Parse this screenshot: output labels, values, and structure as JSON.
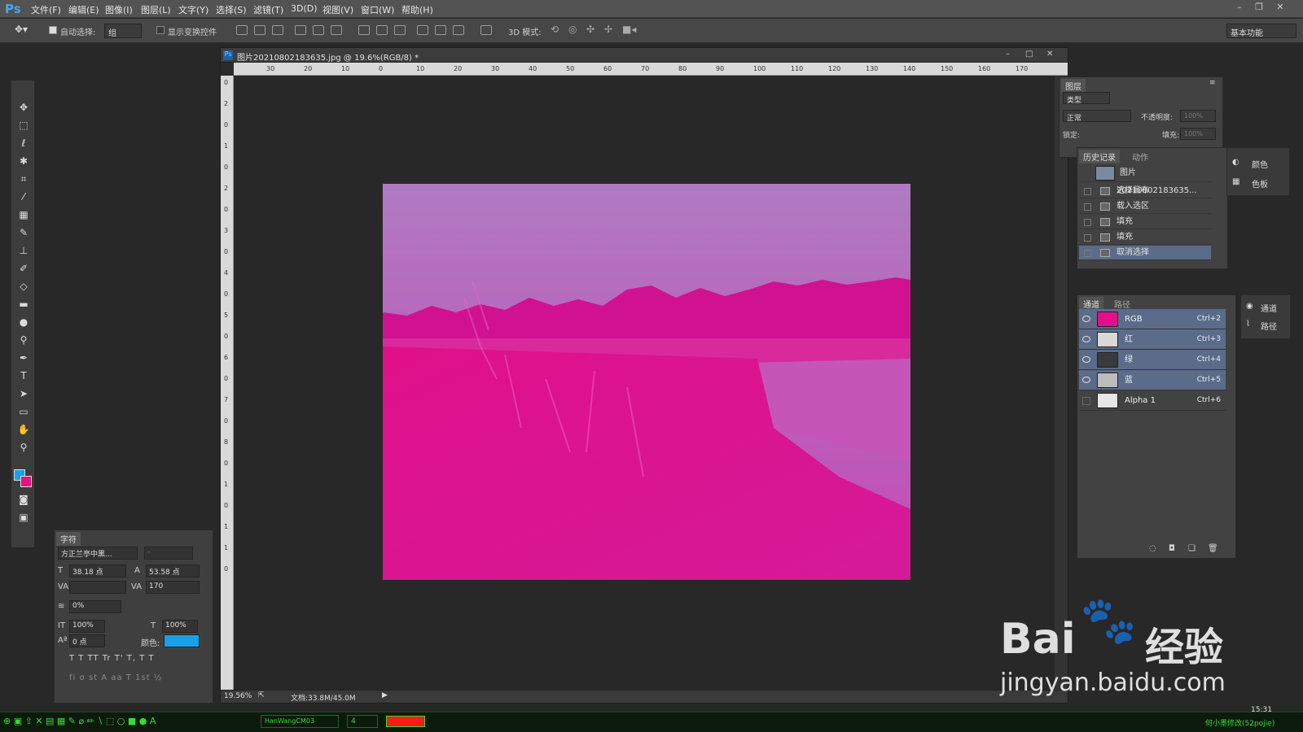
{
  "menubar": {
    "logo": "Ps",
    "items": [
      "文件(F)",
      "编辑(E)",
      "图像(I)",
      "图层(L)",
      "文字(Y)",
      "选择(S)",
      "滤镜(T)",
      "3D(D)",
      "视图(V)",
      "窗口(W)",
      "帮助(H)"
    ]
  },
  "optionsbar": {
    "auto_select_label": "自动选择:",
    "auto_select_value": "组",
    "show_transform_label": "显示变换控件",
    "mode_3d_label": "3D 模式:",
    "workspace": "基本功能"
  },
  "document": {
    "title": "图片20210802183635.jpg @ 19.6%(RGB/8) *",
    "zoom": "19.56%",
    "doc_size": "文档:33.8M/45.0M",
    "ruler_h_labels": [
      "30",
      "20",
      "10",
      "0",
      "10",
      "20",
      "30",
      "40",
      "50",
      "60",
      "70",
      "80",
      "90",
      "100",
      "110",
      "120",
      "130",
      "140",
      "150",
      "160",
      "170"
    ],
    "ruler_v_labels": [
      "0",
      "2",
      "0",
      "1",
      "0",
      "2",
      "0",
      "3",
      "0",
      "4",
      "0",
      "5",
      "0",
      "6",
      "0",
      "7",
      "0",
      "8",
      "0",
      "1",
      "0",
      "1",
      "1",
      "0"
    ]
  },
  "layers_panel": {
    "title": "图层",
    "kind": "类型",
    "blend": "正常",
    "opacity_label": "不透明度:",
    "opacity_value": "100%",
    "lock_label": "锁定:",
    "fill_label": "填充:",
    "fill_value": "100%"
  },
  "history_panel": {
    "tabs": [
      "历史记录",
      "动作"
    ],
    "snapshot": "图片20210802183635...",
    "items": [
      "选择画布",
      "载入选区",
      "填充",
      "填充",
      "取消选择"
    ]
  },
  "side_panels": {
    "color": "颜色",
    "swatches": "色板",
    "channels": "通道",
    "paths": "路径"
  },
  "channels_panel": {
    "tabs": [
      "通道",
      "路径"
    ],
    "channels": [
      {
        "name": "RGB",
        "key": "Ctrl+2"
      },
      {
        "name": "红",
        "key": "Ctrl+3"
      },
      {
        "name": "绿",
        "key": "Ctrl+4"
      },
      {
        "name": "蓝",
        "key": "Ctrl+5"
      },
      {
        "name": "Alpha 1",
        "key": "Ctrl+6"
      }
    ]
  },
  "char_panel": {
    "title": "字符",
    "font_family": "方正兰亭中黑...",
    "font_style": "-",
    "size": "38.18 点",
    "leading": "53.58 点",
    "tracking": "170",
    "scale_pct": "0%",
    "vscale": "100%",
    "hscale": "100%",
    "baseline": "0 点",
    "color_label": "颜色:",
    "color_hex": "#1aa0e8",
    "style_buttons": "T  T  TT  Tr  T'  T,  T  T",
    "opentype_buttons": "fi  σ  st  A  aa  T  1st  ½"
  },
  "taskbar": {
    "font_box": "HanWangCM03",
    "size_box": "4",
    "time": "15:31",
    "right_text": "何小墨修改(52pojie)"
  },
  "watermark": {
    "brand": "Bai",
    "brand2": "经验",
    "url": "jingyan.baidu.com"
  }
}
